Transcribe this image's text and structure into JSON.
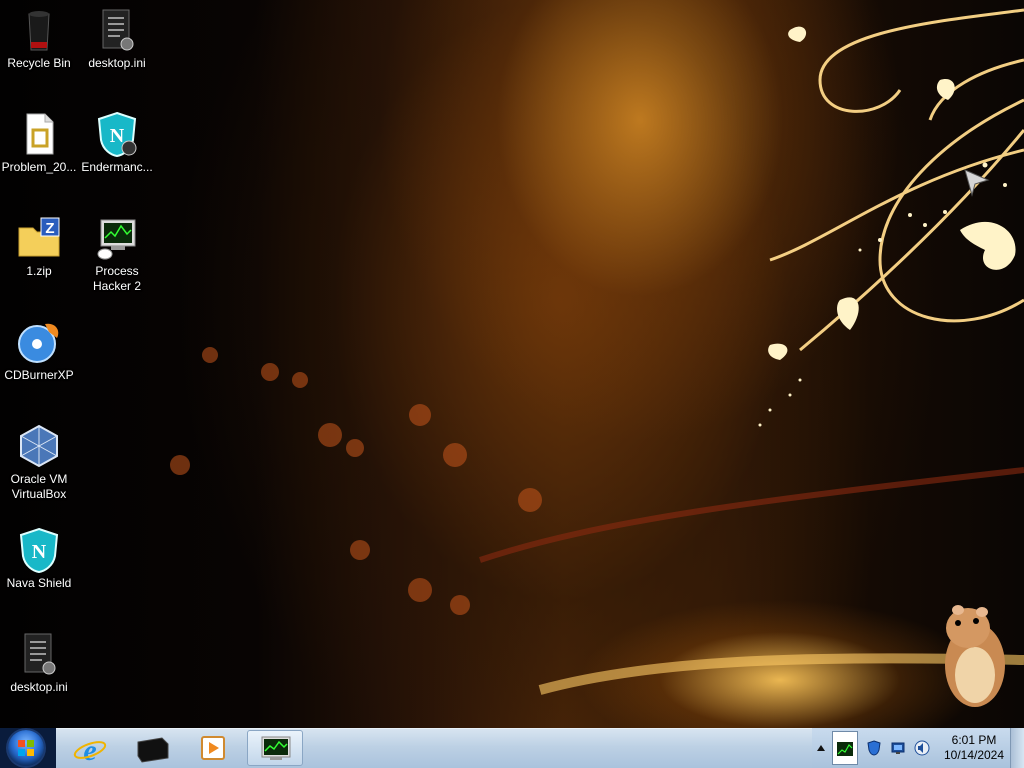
{
  "desktop": {
    "icons": [
      {
        "label": "Recycle Bin",
        "icon": "recycle-bin-icon"
      },
      {
        "label": "desktop.ini",
        "icon": "settings-file-icon"
      },
      {
        "label": "Problem_20...",
        "icon": "document-file-icon"
      },
      {
        "label": "Endermanc...",
        "icon": "shield-app-icon"
      },
      {
        "label": "1.zip",
        "icon": "zip-folder-icon"
      },
      {
        "label": "Process Hacker 2",
        "icon": "process-hacker-icon"
      },
      {
        "label": "CDBurnerXP",
        "icon": "cd-burner-icon"
      },
      {
        "label": "Oracle VM VirtualBox",
        "icon": "virtualbox-icon"
      },
      {
        "label": "Nava Shield",
        "icon": "shield-app-icon"
      },
      {
        "label": "desktop.ini",
        "icon": "settings-file-icon"
      }
    ]
  },
  "taskbar": {
    "start": {
      "icon": "windows-start-icon"
    },
    "pinned": [
      {
        "icon": "internet-explorer-icon"
      },
      {
        "icon": "black-box-app-icon"
      },
      {
        "icon": "media-player-icon"
      },
      {
        "icon": "process-hacker-icon",
        "active": true
      }
    ],
    "tray": {
      "icons": [
        "show-hidden-icons-arrow",
        "process-monitor-icon",
        "shield-tray-icon",
        "network-icon",
        "volume-icon"
      ],
      "time": "6:01 PM",
      "date": "10/14/2024"
    }
  },
  "colors": {
    "taskbar": "#bcd0e4",
    "wallpaper_gold": "#e0962a"
  }
}
